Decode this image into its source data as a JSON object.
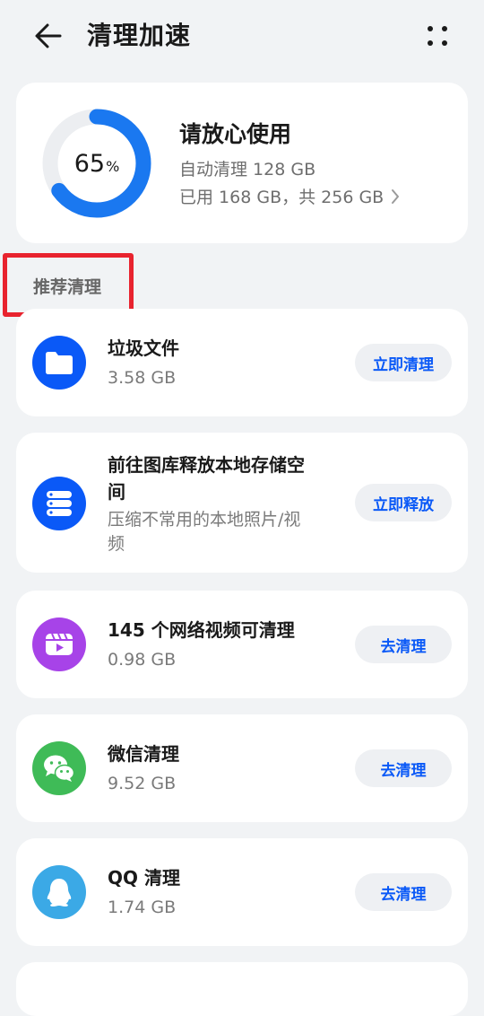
{
  "header": {
    "title": "清理加速",
    "back_icon": "arrow-left-icon",
    "more_icon": "more-vertical-icon"
  },
  "storage": {
    "percent_value": "65",
    "percent_unit": "%",
    "used_fraction": 0.65,
    "headline": "请放心使用",
    "auto_clean": "自动清理 128 GB",
    "usage": "已用 168 GB，共 256 GB",
    "ring_color": "#1a78f0",
    "ring_track_color": "#eceef1"
  },
  "section": {
    "label": "推荐清理"
  },
  "items": [
    {
      "title": "垃圾文件",
      "subtitle": "3.58 GB",
      "action": "立即清理",
      "icon": "folder-icon",
      "color": "#0a59f7"
    },
    {
      "title_line1": "前往图库释放本地存储空",
      "title_line2": "间",
      "subtitle_line1": "压缩不常用的本地照片/视",
      "subtitle_line2": "频",
      "action": "立即释放",
      "icon": "storage-stack-icon",
      "color": "#0a59f7"
    },
    {
      "title": "145 个网络视频可清理",
      "subtitle": "0.98 GB",
      "action": "去清理",
      "icon": "video-icon",
      "color": "#a743e8"
    },
    {
      "title": "微信清理",
      "subtitle": "9.52 GB",
      "action": "去清理",
      "icon": "wechat-icon",
      "color": "#3fbb57"
    },
    {
      "title": "QQ 清理",
      "subtitle": "1.74 GB",
      "action": "去清理",
      "icon": "qq-icon",
      "color": "#3ba9e6"
    }
  ],
  "colors": {
    "accent": "#0a59f7",
    "background": "#f1f3f5",
    "highlight": "#e8232e"
  }
}
